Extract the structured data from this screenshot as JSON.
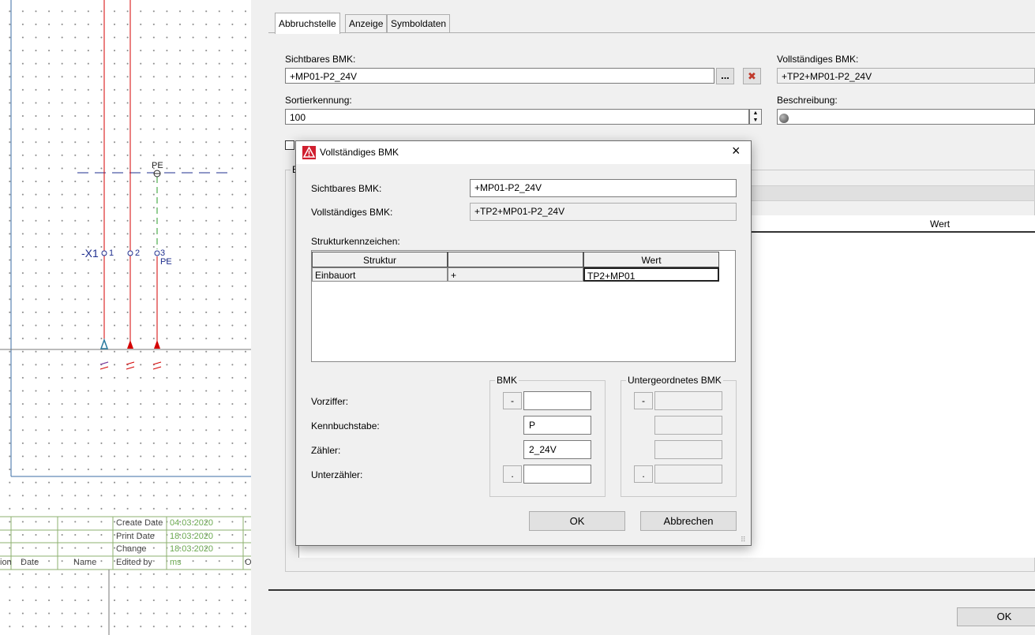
{
  "schematic": {
    "terminal_label": "-X1",
    "pins": [
      "1",
      "2",
      "3"
    ],
    "pe_top": "PE",
    "pe_pin": "PE",
    "title_block": {
      "rows": [
        {
          "label": "Create Date",
          "value": "04.03.2020"
        },
        {
          "label": "Print Date",
          "value": "18.03.2020"
        },
        {
          "label": "Change",
          "value": "18.03.2020"
        }
      ],
      "footer": {
        "col1": "ion",
        "col2": "Date",
        "col3": "Name",
        "col4": "Edited by",
        "col5": "ms",
        "col6": "O"
      }
    }
  },
  "panel": {
    "tabs": [
      "Abbruchstelle",
      "Anzeige",
      "Symboldaten"
    ],
    "sichtbares_label": "Sichtbares BMK:",
    "sichtbares_value": "+MP01-P2_24V",
    "browse_label": "...",
    "vollstaendiges_label": "Vollständiges BMK:",
    "vollstaendiges_value": "+TP2+MP01-P2_24V",
    "sortier_label": "Sortierkennung:",
    "sortier_value": "100",
    "beschreibung_label": "Beschreibung:",
    "beschreibung_value": "",
    "partial_b": "E",
    "wert_header": "Wert",
    "ok_label": "OK"
  },
  "dialog": {
    "title": "Vollständiges BMK",
    "sichtbares_label": "Sichtbares BMK:",
    "sichtbares_value": "+MP01-P2_24V",
    "vollstaendiges_label": "Vollständiges BMK:",
    "vollstaendiges_value": "+TP2+MP01-P2_24V",
    "struktur_label": "Strukturkennzeichen:",
    "columns": [
      "Struktur",
      "",
      "Wert"
    ],
    "rows": [
      {
        "struktur": "Einbauort",
        "prefix": "+",
        "wert": "TP2+MP01"
      }
    ],
    "bmk_group": "BMK",
    "unter_group": "Untergeordnetes BMK",
    "vorziffer_label": "Vorziffer:",
    "kennbuchstabe_label": "Kennbuchstabe:",
    "zaehler_label": "Zähler:",
    "unterzaehler_label": "Unterzähler:",
    "vorziffer_prefix": "-",
    "unterzaehler_prefix": ".",
    "kennbuchstabe_value": "P",
    "zaehler_value": "2_24V",
    "ok_label": "OK",
    "cancel_label": "Abbrechen"
  }
}
